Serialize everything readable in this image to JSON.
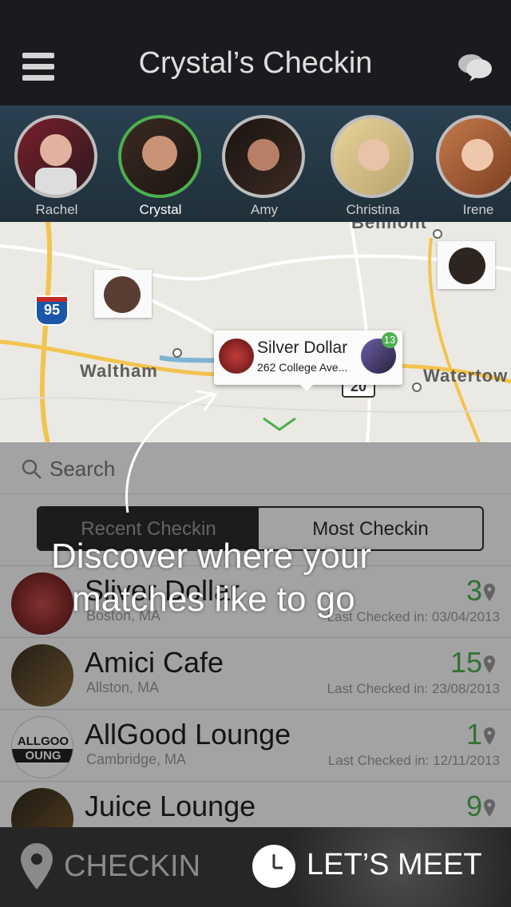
{
  "header": {
    "title": "Crystal’s Checkin"
  },
  "people": [
    {
      "name": "Rachel",
      "selected": false
    },
    {
      "name": "Crystal",
      "selected": true
    },
    {
      "name": "Amy",
      "selected": false
    },
    {
      "name": "Christina",
      "selected": false
    },
    {
      "name": "Irene",
      "selected": false
    }
  ],
  "map": {
    "labels": [
      "Waltham",
      "Watertow",
      "Belmont"
    ],
    "shields": [
      "95",
      "20"
    ],
    "callout": {
      "name": "Silver Dollar",
      "address": "262 College Ave...",
      "badge": "13"
    }
  },
  "search": {
    "label": "Search"
  },
  "segments": {
    "left": "Recent Checkin",
    "right": "Most Checkin"
  },
  "coach": {
    "line1": "Discover where your",
    "line2": "matches like to go"
  },
  "venues": [
    {
      "name": "Sliver Dollar",
      "city": "Boston, MA",
      "count": "3",
      "last": "Last Checked in: 03/04/2013"
    },
    {
      "name": "Amici Cafe",
      "city": "Allston, MA",
      "count": "15",
      "last": "Last Checked in: 23/08/2013"
    },
    {
      "name": "AllGood Lounge",
      "city": "Cambridge, MA",
      "count": "1",
      "last": "Last Checked in: 12/11/2013"
    },
    {
      "name": "Juice Lounge",
      "city": "",
      "count": "9",
      "last": ""
    }
  ],
  "bottom": {
    "checkin": "CHECKIN",
    "meet": "LET’S MEET"
  },
  "colors": {
    "accent": "#4caf50",
    "topbar": "#1a1b1e",
    "bottombar": "#262627"
  }
}
